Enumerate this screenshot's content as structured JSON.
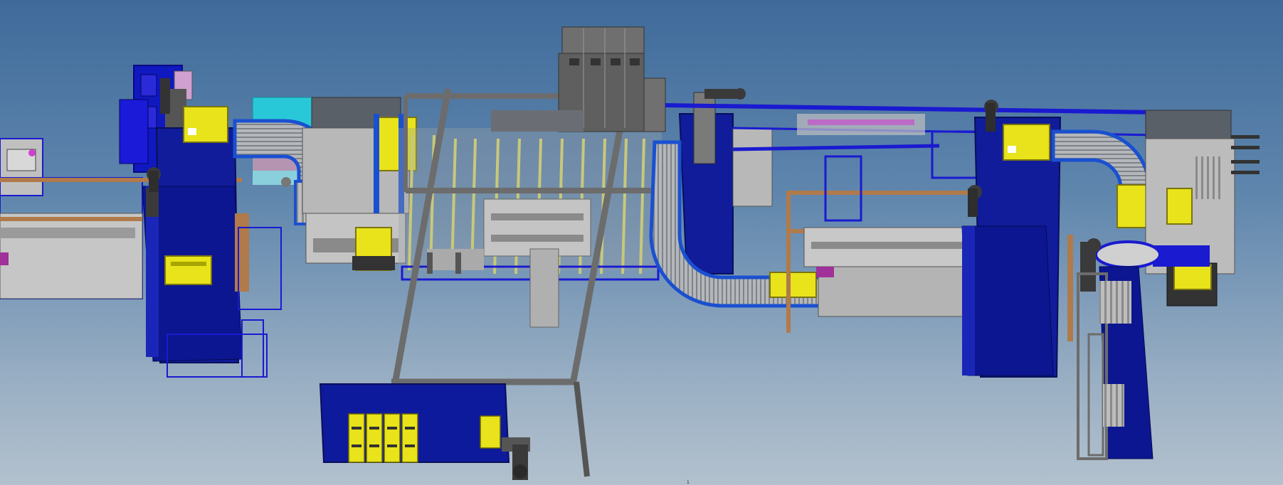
{
  "viewport": {
    "background_top": "#3f6a9a",
    "background_bottom": "#b3c1ce"
  },
  "colors": {
    "frame_blue": "#1616c8",
    "panel_blue": "#10189a",
    "roller_grey": "#a9acb0",
    "steel_grey": "#6c6c6c",
    "tote_yellow": "#e8e31a",
    "cyan_block": "#28c8d8",
    "copper_rail": "#b07a4a",
    "machine_light": "#c8c8c8",
    "machine_dark": "#5a5a5a",
    "magenta_detail": "#d040d0"
  },
  "scene": {
    "label_fragment": "1"
  }
}
